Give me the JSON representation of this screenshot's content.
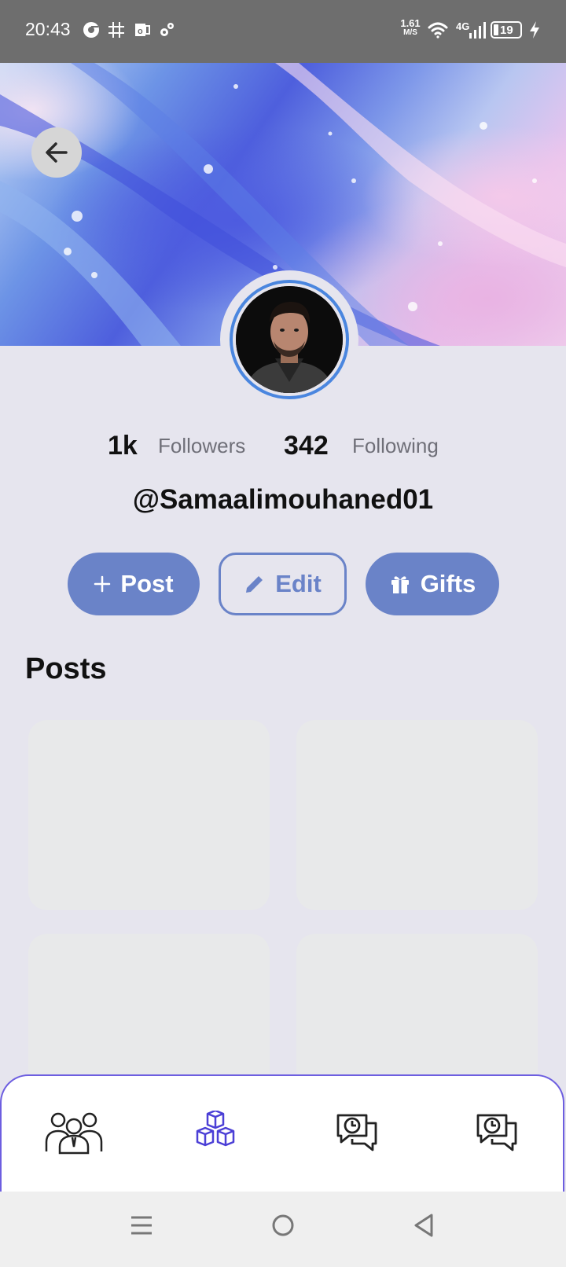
{
  "status_bar": {
    "time": "20:43",
    "network_speed_value": "1.61",
    "network_speed_unit": "M/S",
    "network_type": "4G",
    "battery": "19",
    "icons": [
      "chrome-icon",
      "grid-icon",
      "outlook-icon",
      "settings-icon",
      "wifi-icon",
      "signal-icon",
      "battery-icon",
      "charging-icon"
    ]
  },
  "profile": {
    "followers_count": "1k",
    "followers_label": "Followers",
    "following_count": "342",
    "following_label": "Following",
    "username": "@Samaalimouhaned01"
  },
  "actions": {
    "post_label": "Post",
    "edit_label": "Edit",
    "gifts_label": "Gifts"
  },
  "posts": {
    "title": "Posts"
  },
  "bottom_nav": {
    "items": [
      "people-icon",
      "cubes-icon",
      "chat-clock-icon",
      "chat-clock-icon"
    ],
    "active_index": 1
  },
  "system_nav": {
    "items": [
      "menu-icon",
      "home-icon",
      "back-triangle-icon"
    ]
  },
  "colors": {
    "accent": "#6a83c8",
    "active_nav": "#4b3fd6",
    "background": "#e6e5ee"
  }
}
